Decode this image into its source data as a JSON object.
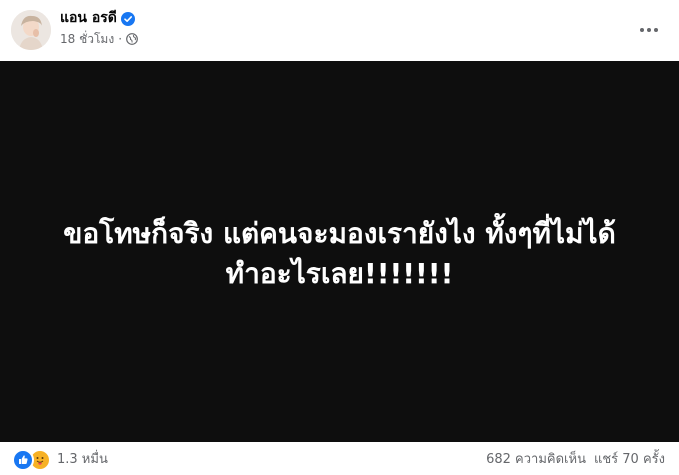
{
  "post": {
    "author": "แอน อรดี",
    "time": "18 ชั่วโมง",
    "separator": "·",
    "media_text_line1": "ขอโทษก็จริง แต่คนจะมองเรายังไง ทั้งๆที่ไม่ได้",
    "media_text_line2": "ทำอะไรเลย!!!!!!!",
    "reaction_count": "1.3 หมื่น",
    "comments": "682 ความคิดเห็น",
    "shares": "แชร์ 70 ครั้ง"
  },
  "icons": {
    "verified": "verified-badge-icon",
    "privacy": "globe-icon",
    "more": "more-options-icon",
    "like": "like-icon",
    "care": "care-icon"
  },
  "colors": {
    "accent": "#1877f2",
    "media_bg": "#0e0e0e",
    "meta_text": "#65676b",
    "care": "#f7b125"
  }
}
